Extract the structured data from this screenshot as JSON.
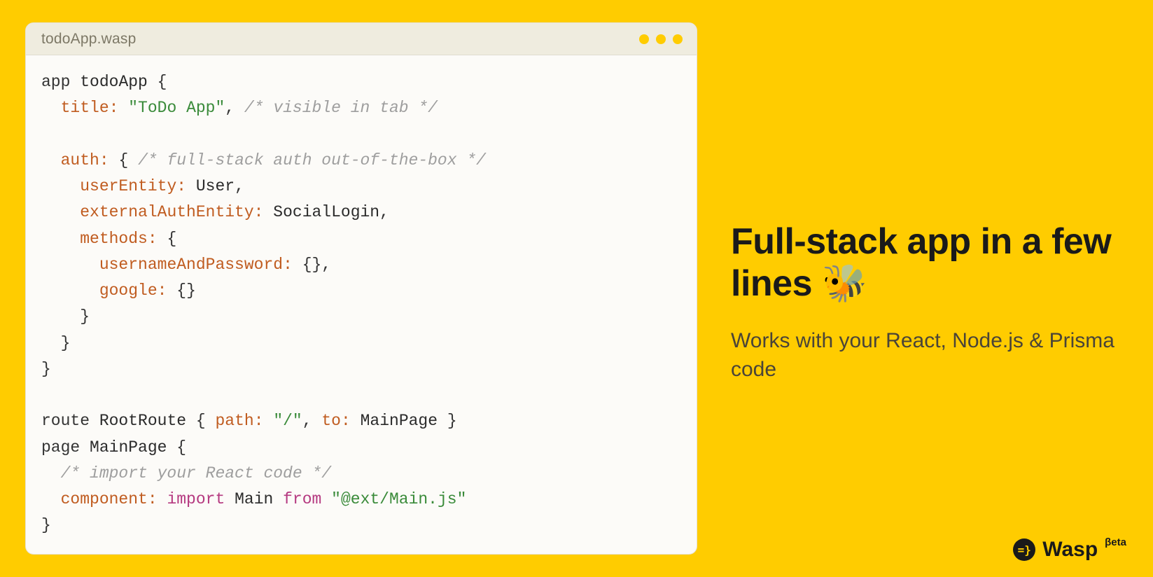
{
  "window": {
    "filename": "todoApp.wasp"
  },
  "code": {
    "t_app": "app",
    "t_appname": "todoApp",
    "t_title_k": "title:",
    "t_title_v": "\"ToDo App\"",
    "t_title_c": "/* visible in tab */",
    "t_auth_k": "auth:",
    "t_auth_c": "/* full-stack auth out-of-the-box */",
    "t_userEntity_k": "userEntity:",
    "t_userEntity_v": "User",
    "t_extAuth_k": "externalAuthEntity:",
    "t_extAuth_v": "SocialLogin",
    "t_methods_k": "methods:",
    "t_up_k": "usernameAndPassword:",
    "t_google_k": "google:",
    "t_route": "route",
    "t_rootroute": "RootRoute",
    "t_path_k": "path:",
    "t_path_v": "\"/\"",
    "t_to_k": "to:",
    "t_to_v": "MainPage",
    "t_page": "page",
    "t_mainpage": "MainPage",
    "t_import_c": "/* import your React code */",
    "t_component_k": "component:",
    "t_import": "import",
    "t_main": "Main",
    "t_from": "from",
    "t_path_str": "\"@ext/Main.js\""
  },
  "right": {
    "heading": "Full-stack app in a few lines 🐝",
    "sub": "Works with your React, Node.js & Prisma code"
  },
  "brand": {
    "logo_glyph": "=}",
    "name": "Wasp",
    "badge": "βeta"
  }
}
